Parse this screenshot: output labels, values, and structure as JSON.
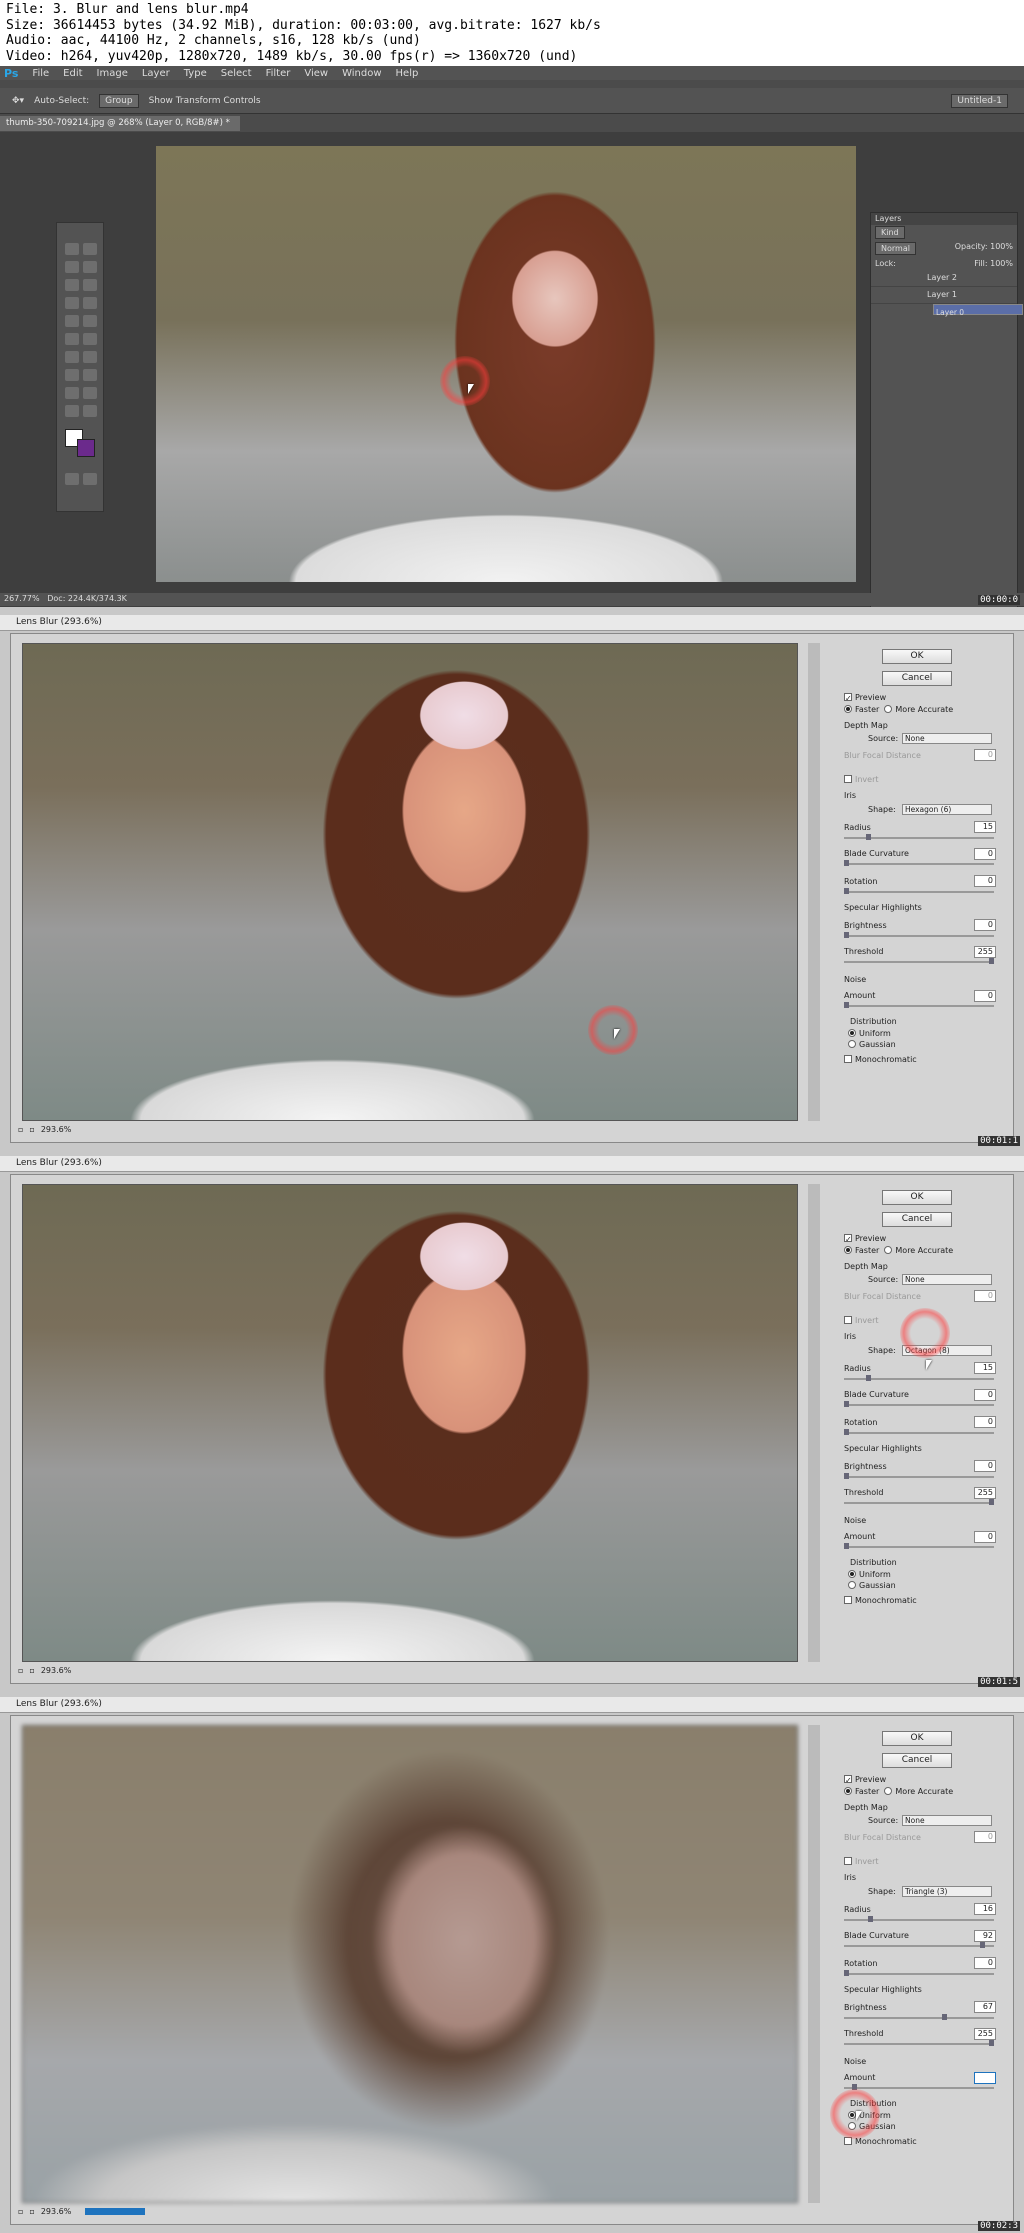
{
  "info": {
    "line1": "File: 3. Blur and lens blur.mp4",
    "line2": "Size: 36614453 bytes (34.92 MiB), duration: 00:03:00, avg.bitrate: 1627 kb/s",
    "line3": "Audio: aac, 44100 Hz, 2 channels, s16, 128 kb/s (und)",
    "line4": "Video: h264, yuv420p, 1280x720, 1489 kb/s, 30.00 fps(r) => 1360x720 (und)"
  },
  "frame1": {
    "app_logo": "Ps",
    "menu": [
      "File",
      "Edit",
      "Image",
      "Layer",
      "Type",
      "Select",
      "Filter",
      "View",
      "Window",
      "Help"
    ],
    "options": {
      "auto_select": "Auto-Select:",
      "group": "Group",
      "transform": "Show Transform Controls",
      "workspace": "Untitled-1"
    },
    "doc_tab": "thumb-350-709214.jpg @ 268% (Layer 0, RGB/8#) *",
    "layers": {
      "title": "Layers",
      "kind": "Kind",
      "blend": "Normal",
      "opacity_label": "Opacity:",
      "opacity": "100%",
      "lock_label": "Lock:",
      "fill_label": "Fill:",
      "fill": "100%",
      "items": [
        "Layer 2",
        "Layer 1",
        "Layer 0"
      ]
    },
    "status_zoom": "267.77%",
    "status_doc": "Doc: 224.4K/374.3K",
    "timestamp": "00:00:0"
  },
  "dialog": {
    "title": "Lens Blur (293.6%)",
    "ok": "OK",
    "cancel": "Cancel",
    "preview": "Preview",
    "faster": "Faster",
    "more_accurate": "More Accurate",
    "depth_map": "Depth Map",
    "source_label": "Source:",
    "source": "None",
    "blur_focal": "Blur Focal Distance",
    "blur_focal_value": "0",
    "invert": "Invert",
    "iris": "Iris",
    "shape_label": "Shape:",
    "radius": "Radius",
    "blade": "Blade Curvature",
    "rotation": "Rotation",
    "specular": "Specular Highlights",
    "brightness": "Brightness",
    "threshold": "Threshold",
    "noise": "Noise",
    "amount": "Amount",
    "distribution": "Distribution",
    "uniform": "Uniform",
    "gaussian": "Gaussian",
    "monochromatic": "Monochromatic",
    "zoom": "293.6%"
  },
  "frame2": {
    "shape": "Hexagon (6)",
    "radius": "15",
    "blade": "0",
    "rotation": "0",
    "brightness": "0",
    "threshold": "255",
    "amount": "0",
    "timestamp": "00:01:1"
  },
  "frame3": {
    "shape": "Octagon (8)",
    "radius": "15",
    "blade": "0",
    "rotation": "0",
    "brightness": "0",
    "threshold": "255",
    "amount": "0",
    "timestamp": "00:01:5"
  },
  "frame4": {
    "shape": "Triangle (3)",
    "radius": "16",
    "blade": "92",
    "rotation": "0",
    "brightness": "67",
    "threshold": "255",
    "amount": "",
    "timestamp": "00:02:3"
  }
}
